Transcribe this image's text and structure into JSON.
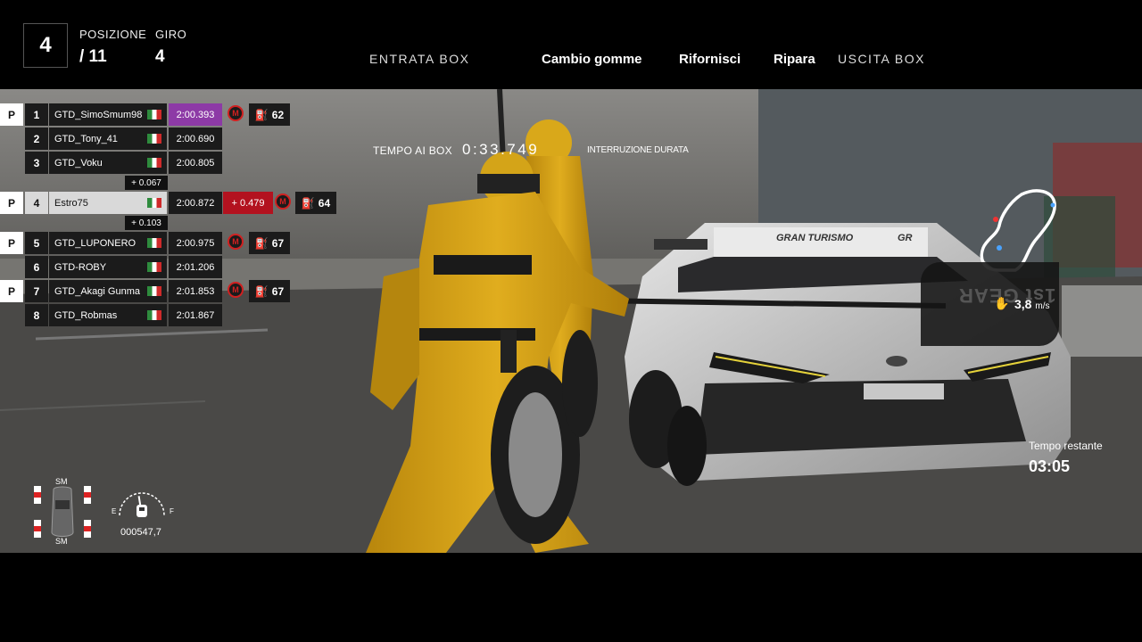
{
  "hud": {
    "position": "4",
    "position_label": "POSIZIONE",
    "total_positions": "/ 11",
    "lap_label": "GIRO",
    "lap": "4"
  },
  "pit_menu": {
    "entry": "ENTRATA BOX",
    "tyres": "Cambio gomme",
    "refuel": "Rifornisci",
    "repair": "Ripara",
    "exit": "USCITA BOX"
  },
  "pit_timer": {
    "label": "TEMPO AI BOX",
    "value": "0:33.749",
    "duration_label": "INTERRUZIONE DURATA"
  },
  "leaderboard": [
    {
      "p": "P",
      "pos": "1",
      "name": "GTD_SimoSmum98",
      "time": "2:00.393",
      "time_highlight": "purple",
      "gap": "",
      "m": "M",
      "fuel": "62"
    },
    {
      "p": "",
      "pos": "2",
      "name": "GTD_Tony_41",
      "time": "2:00.690",
      "time_highlight": "",
      "gap": "",
      "m": "",
      "fuel": ""
    },
    {
      "p": "",
      "pos": "3",
      "name": "GTD_Voku",
      "time": "2:00.805",
      "time_highlight": "",
      "gap": "",
      "m": "",
      "fuel": ""
    },
    {
      "p": "P",
      "pos": "4",
      "name": "Estro75",
      "time": "2:00.872",
      "time_highlight": "",
      "gap": "+ 0.479",
      "m": "M",
      "fuel": "64"
    },
    {
      "p": "P",
      "pos": "5",
      "name": "GTD_LUPONERO",
      "time": "2:00.975",
      "time_highlight": "",
      "gap": "",
      "m": "M",
      "fuel": "67"
    },
    {
      "p": "",
      "pos": "6",
      "name": "GTD-ROBY",
      "time": "2:01.206",
      "time_highlight": "",
      "gap": "",
      "m": "",
      "fuel": ""
    },
    {
      "p": "P",
      "pos": "7",
      "name": "GTD_Akagi Gunma",
      "time": "2:01.853",
      "time_highlight": "",
      "gap": "",
      "m": "M",
      "fuel": "67"
    },
    {
      "p": "",
      "pos": "8",
      "name": "GTD_Robmas",
      "time": "2:01.867",
      "time_highlight": "",
      "gap": "",
      "m": "",
      "fuel": ""
    }
  ],
  "gaps": {
    "gap_to_4": "+ 0.067",
    "gap_to_5": "+ 0.103"
  },
  "car_hud": {
    "gear": "1st GEAR",
    "speed": "3,8",
    "speed_unit": "m/s",
    "remaining_label": "Tempo restante",
    "remaining_value": "03:05"
  },
  "vehicle": {
    "tyre_front": "SM",
    "tyre_rear": "SM",
    "fuel_empty": "E",
    "fuel_full": "F",
    "fuel_level": 0.45,
    "odometer": "000547,7"
  },
  "car_livery": {
    "brand": "GRAN TURISMO",
    "badge": "GR"
  },
  "colors": {
    "purple_time": "#8d3aa6",
    "gap_red": "#b3121f",
    "mechanic_yellow": "#d4a418"
  }
}
